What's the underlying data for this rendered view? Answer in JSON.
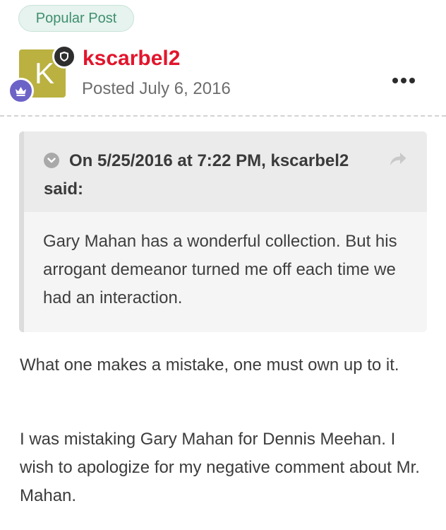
{
  "post": {
    "badge": "Popular Post",
    "avatar_letter": "K",
    "author": "kscarbel2",
    "posted": "Posted July 6, 2016"
  },
  "quote": {
    "meta": "On 5/25/2016 at 7:22 PM, kscarbel2 said:",
    "body": "Gary Mahan has a wonderful collection. But his arrogant demeanor turned me off each time we had an interaction."
  },
  "content": {
    "paragraphs": [
      "What one makes a mistake, one must own up to it.",
      "I was mistaking Gary Mahan for Dennis Meehan. I wish to apologize for my negative comment about Mr. Mahan."
    ]
  },
  "icons": {
    "shield": "shield-icon",
    "rank": "crown-rank-icon",
    "more": "more-options-icon",
    "toggle": "chevron-down-icon",
    "share": "share-arrow-icon"
  },
  "colors": {
    "author": "#e2152c",
    "badge_text": "#3f8f6f",
    "badge_bg": "#e6f3ee",
    "avatar_bg": "#bab140",
    "rank_badge": "#6c63c7"
  }
}
